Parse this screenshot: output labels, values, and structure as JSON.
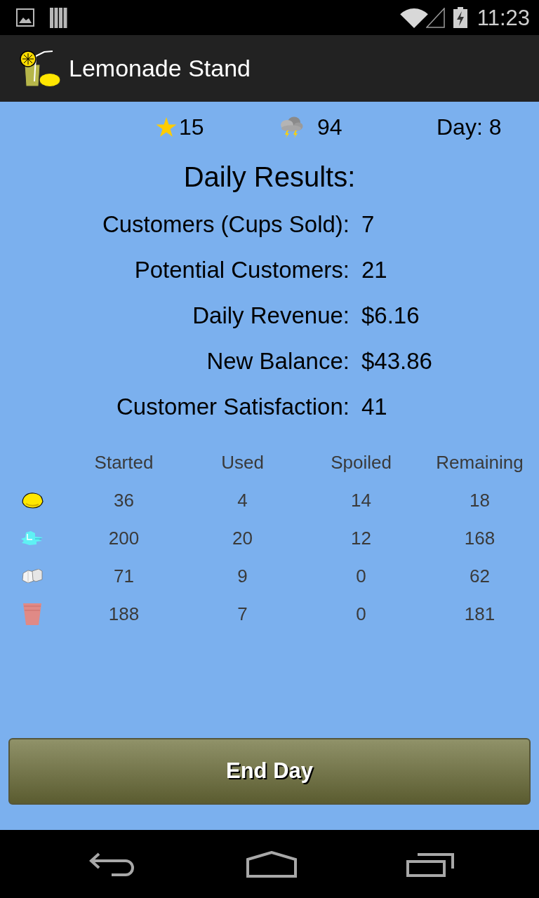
{
  "status_bar": {
    "time": "11:23"
  },
  "app_bar": {
    "title": "Lemonade Stand"
  },
  "stats": [
    {
      "kind": "star",
      "value": "15"
    },
    {
      "kind": "weather",
      "value": "94"
    },
    {
      "kind": "text",
      "value": "Day: 8"
    }
  ],
  "results": {
    "title": "Daily Results:",
    "rows": [
      {
        "label": "Customers (Cups Sold):",
        "value": "7"
      },
      {
        "label": "Potential Customers:",
        "value": "21"
      },
      {
        "label": "Daily Revenue:",
        "value": "$6.16"
      },
      {
        "label": "New Balance:",
        "value": "$43.86"
      },
      {
        "label": "Customer Satisfaction:",
        "value": "41"
      }
    ]
  },
  "inventory": {
    "columns": [
      "Started",
      "Used",
      "Spoiled",
      "Remaining"
    ],
    "rows": [
      {
        "kind": "lemon",
        "values": [
          "36",
          "4",
          "14",
          "18"
        ]
      },
      {
        "kind": "ice",
        "values": [
          "200",
          "20",
          "12",
          "168"
        ]
      },
      {
        "kind": "sugar",
        "values": [
          "71",
          "9",
          "0",
          "62"
        ]
      },
      {
        "kind": "cup",
        "values": [
          "188",
          "7",
          "0",
          "181"
        ]
      }
    ]
  },
  "button": {
    "label": "End Day"
  }
}
